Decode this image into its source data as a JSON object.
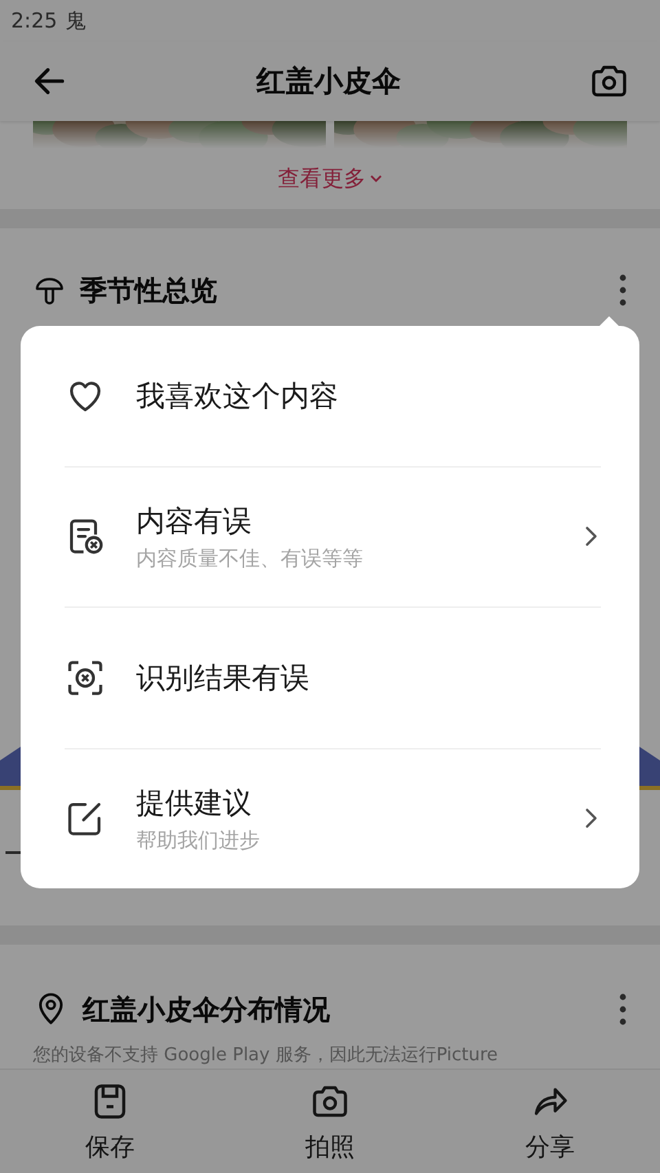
{
  "status_bar": {
    "time": "2:25",
    "notification_glyph": "鬼"
  },
  "app_bar": {
    "title": "红盖小皮伞"
  },
  "gallery": {
    "see_more": "查看更多"
  },
  "sections": [
    {
      "title": "季节性总览"
    },
    {
      "title": "红盖小皮伞分布情况",
      "notice": "您的设备不支持 Google Play 服务，因此无法运行Picture"
    }
  ],
  "menu": {
    "items": [
      {
        "title": "我喜欢这个内容",
        "has_arrow": false
      },
      {
        "title": "内容有误",
        "subtitle": "内容质量不佳、有误等等",
        "has_arrow": true
      },
      {
        "title": "识别结果有误",
        "has_arrow": false
      },
      {
        "title": "提供建议",
        "subtitle": "帮助我们进步",
        "has_arrow": true
      }
    ]
  },
  "bottom_nav": [
    {
      "label": "保存"
    },
    {
      "label": "拍照"
    },
    {
      "label": "分享"
    }
  ]
}
